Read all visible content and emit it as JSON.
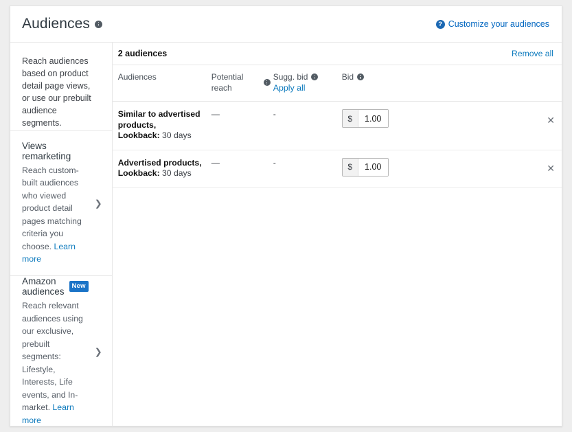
{
  "header": {
    "title": "Audiences",
    "info_icon": "info-icon",
    "customize_link": "Customize your audiences",
    "customize_icon": "help-circle-icon"
  },
  "left_panel": {
    "intro": "Reach audiences based on product detail page views, or use our prebuilt audience segments.",
    "options": [
      {
        "title": "Views remarketing",
        "badge": "",
        "description": "Reach custom-built audiences who viewed product detail pages matching criteria you choose.",
        "learn_more": "Learn more",
        "chevron_icon": "chevron-right-icon"
      },
      {
        "title": "Amazon audiences",
        "badge": "New",
        "description": "Reach relevant audiences using our exclusive, prebuilt segments: Lifestyle, Interests, Life events, and In-market.",
        "learn_more": "Learn more",
        "chevron_icon": "chevron-right-icon"
      }
    ]
  },
  "right_panel": {
    "count_label": "2 audiences",
    "remove_all_label": "Remove all",
    "columns": {
      "audiences": "Audiences",
      "potential_reach": "Potential reach",
      "sugg_bid": "Sugg. bid",
      "apply_all": "Apply all",
      "bid": "Bid"
    },
    "rows": [
      {
        "name": "Similar to advertised products,",
        "lookback_label": "Lookback:",
        "lookback_value": "30 days",
        "potential_reach": "—",
        "sugg_bid": "-",
        "bid_currency": "$",
        "bid_value": "1.00",
        "remove_icon": "close-icon"
      },
      {
        "name": "Advertised products,",
        "lookback_label": "Lookback:",
        "lookback_value": "30 days",
        "potential_reach": "—",
        "sugg_bid": "-",
        "bid_currency": "$",
        "bid_value": "1.00",
        "remove_icon": "close-icon"
      }
    ]
  },
  "colors": {
    "link": "#0d7abd",
    "badge_blue": "#1a73c7",
    "help_blue": "#1b68b3",
    "text": "#111111",
    "muted": "#565d66"
  }
}
